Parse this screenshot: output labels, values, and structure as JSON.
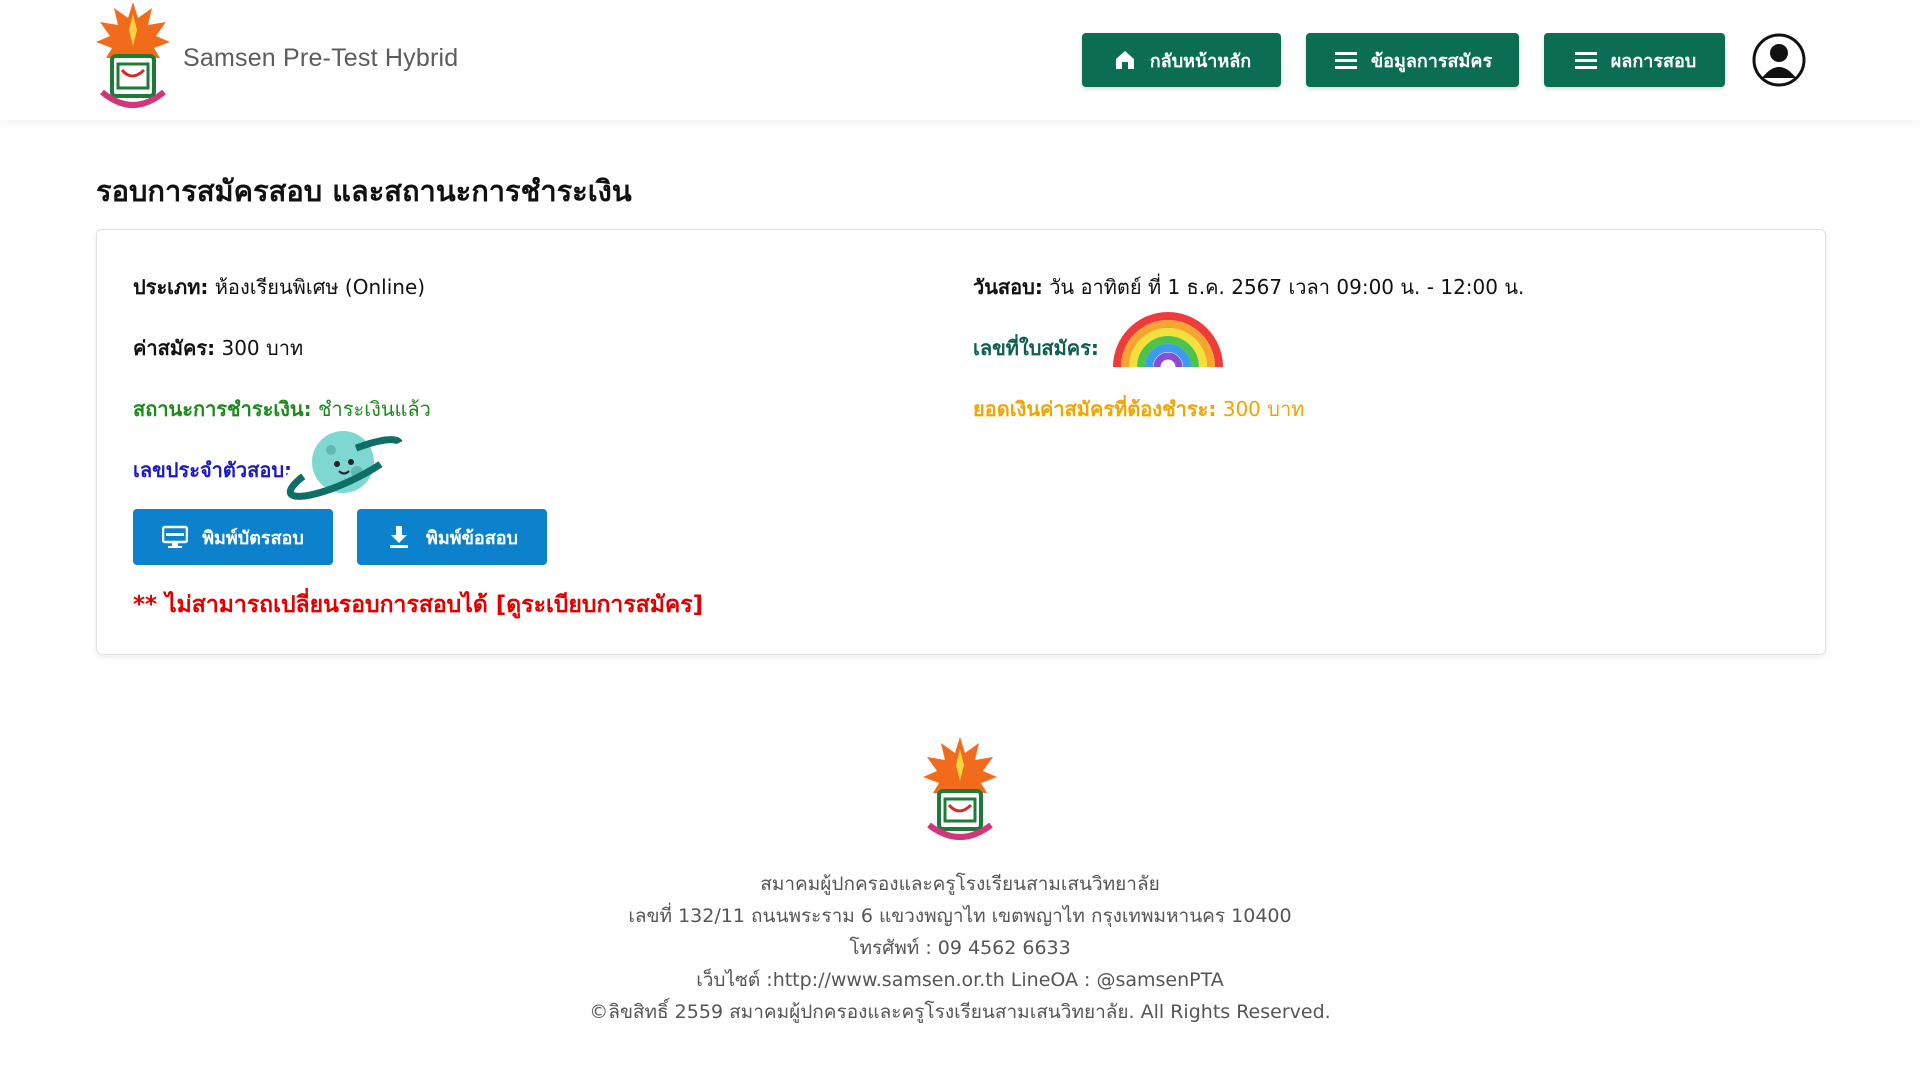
{
  "header": {
    "app_title": "Samsen Pre-Test Hybrid",
    "nav": [
      {
        "label": "กลับหน้าหลัก",
        "icon": "home-icon"
      },
      {
        "label": "ข้อมูลการสมัคร",
        "icon": "menu-icon"
      },
      {
        "label": "ผลการสอบ",
        "icon": "menu-icon"
      }
    ],
    "avatar_icon": "user-circle-icon",
    "brand_color": "#0b6e52"
  },
  "page": {
    "title": "รอบการสมัครสอบ และสถานะการชำระเงิน"
  },
  "card": {
    "type_label": "ประเภท:",
    "type_value": "ห้องเรียนพิเศษ (Online)",
    "fee_label": "ค่าสมัคร:",
    "fee_value": "300 บาท",
    "pay_status_label": "สถานะการชำระเงิน:",
    "pay_status_value": "ชำระเงินแล้ว",
    "exam_id_label": "เลขประจำตัวสอบ:",
    "exam_date_label": "วันสอบ:",
    "exam_date_value": "วัน อาทิตย์ ที่ 1 ธ.ค. 2567 เวลา 09:00 น. - 12:00 น.",
    "app_no_label": "เลขที่ใบสมัคร:",
    "amount_due_label": "ยอดเงินค่าสมัครที่ต้องชำระ:",
    "amount_due_value": "300 บาท",
    "print_card_label": "พิมพ์บัตรสอบ",
    "print_exam_label": "พิมพ์ข้อสอบ",
    "warning_text": "** ไม่สามารถเปลี่ยนรอบการสอบได้",
    "warning_link": "[ดูระเบียบการสมัคร]",
    "colors": {
      "green": "#1e8a1e",
      "orange": "#f0a500",
      "blue": "#1a1ac8",
      "button": "#0c82cc",
      "warning": "#e00000"
    }
  },
  "footer": {
    "org": "สมาคมผู้ปกครองและครูโรงเรียนสามเสนวิทยาลัย",
    "address": "เลขที่ 132/11 ถนนพระราม 6 แขวงพญาไท เขตพญาไท กรุงเทพมหานคร 10400",
    "phone": "โทรศัพท์ : 09 4562 6633",
    "web": "เว็บไซต์ :http://www.samsen.or.th  LineOA : @samsenPTA",
    "copyright": "©ลิขสิทธิ์ 2559 สมาคมผู้ปกครองและครูโรงเรียนสามเสนวิทยาลัย. All Rights Reserved."
  }
}
